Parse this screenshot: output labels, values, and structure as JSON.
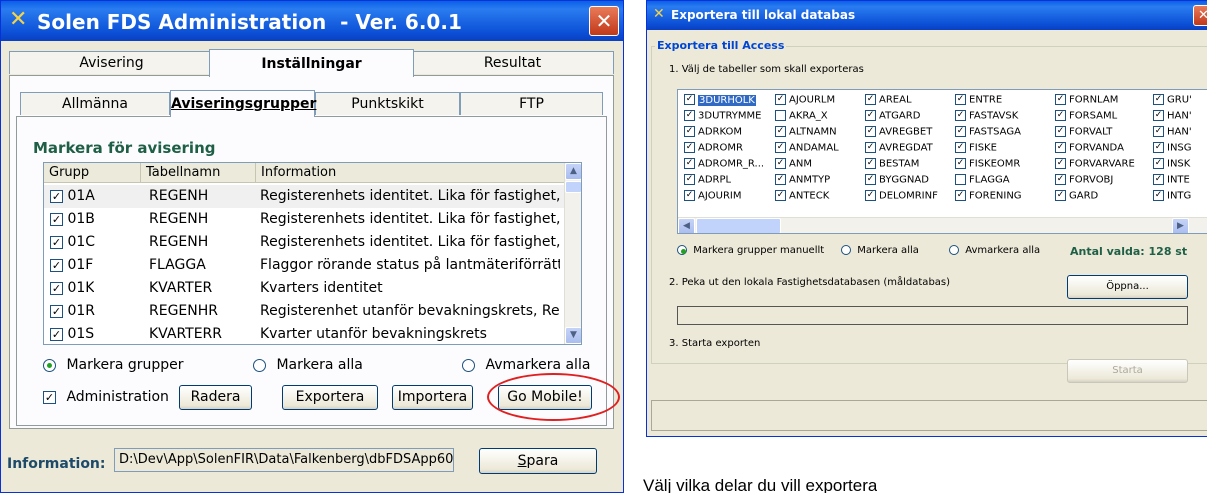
{
  "win1": {
    "title": "Solen FDS Administration  - Ver. 6.0.1",
    "tabs_top": [
      "Avisering",
      "Inställningar",
      "Resultat"
    ],
    "tabs_sub": [
      "Allmänna",
      "Aviseringsgrupper",
      "Punktskikt",
      "FTP"
    ],
    "section_title": "Markera för avisering",
    "columns": [
      "Grupp",
      "Tabellnamn",
      "Information"
    ],
    "rows": [
      {
        "grupp": "01A",
        "tabell": "REGENH",
        "info": "Registerenhets identitet. Lika för fastighet, sa"
      },
      {
        "grupp": "01B",
        "tabell": "REGENH",
        "info": "Registerenhets identitet. Lika för fastighet, sa"
      },
      {
        "grupp": "01C",
        "tabell": "REGENH",
        "info": "Registerenhets identitet. Lika för fastighet, sa"
      },
      {
        "grupp": "01F",
        "tabell": "FLAGGA",
        "info": "Flaggor rörande status på lantmäteriförrättning"
      },
      {
        "grupp": "01K",
        "tabell": "KVARTER",
        "info": "Kvarters identitet"
      },
      {
        "grupp": "01R",
        "tabell": "REGENHR",
        "info": "Registerenhet utanför bevakningskrets, Regis..."
      },
      {
        "grupp": "01S",
        "tabell": "KVARTERR",
        "info": "Kvarter utanför bevakningskrets"
      }
    ],
    "radio": [
      "Markera grupper",
      "Markera alla",
      "Avmarkera alla"
    ],
    "admin_label": "Administration",
    "buttons": [
      "Radera",
      "Exportera",
      "Importera",
      "Go Mobile!"
    ],
    "info_label": "Information:",
    "info_path": "D:\\Dev\\App\\SolenFIR\\Data\\Falkenberg\\dbFDSApp60.",
    "save_label": "Spara",
    "save_accel": "S",
    "save_rest": "para"
  },
  "win2": {
    "title": "Exportera till lokal databas",
    "group_title": "Exportera till Access",
    "step1": "1. Välj de tabeller som skall exporteras",
    "columns": [
      [
        {
          "t": "3DURHOLK",
          "c": true
        },
        {
          "t": "3DUTRYMME",
          "c": true
        },
        {
          "t": "ADRKOM",
          "c": true
        },
        {
          "t": "ADROMR",
          "c": true
        },
        {
          "t": "ADROMR_R...",
          "c": true
        },
        {
          "t": "ADRPL",
          "c": true
        },
        {
          "t": "AJOURIM",
          "c": true
        }
      ],
      [
        {
          "t": "AJOURLM",
          "c": true
        },
        {
          "t": "AKRA_X",
          "c": false
        },
        {
          "t": "ALTNAMN",
          "c": true
        },
        {
          "t": "ANDAMAL",
          "c": true
        },
        {
          "t": "ANM",
          "c": true
        },
        {
          "t": "ANMTYP",
          "c": true
        },
        {
          "t": "ANTECK",
          "c": true
        }
      ],
      [
        {
          "t": "AREAL",
          "c": true
        },
        {
          "t": "ATGARD",
          "c": true
        },
        {
          "t": "AVREGBET",
          "c": true
        },
        {
          "t": "AVREGDAT",
          "c": true
        },
        {
          "t": "BESTAM",
          "c": true
        },
        {
          "t": "BYGGNAD",
          "c": true
        },
        {
          "t": "DELOMRINF",
          "c": true
        }
      ],
      [
        {
          "t": "ENTRE",
          "c": true
        },
        {
          "t": "FASTAVSK",
          "c": true
        },
        {
          "t": "FASTSAGA",
          "c": true
        },
        {
          "t": "FISKE",
          "c": true
        },
        {
          "t": "FISKEOMR",
          "c": true
        },
        {
          "t": "FLAGGA",
          "c": false
        },
        {
          "t": "FORENING",
          "c": true
        }
      ],
      [
        {
          "t": "FORNLAM",
          "c": true
        },
        {
          "t": "FORSAML",
          "c": true
        },
        {
          "t": "FORVALT",
          "c": true
        },
        {
          "t": "FORVANDA",
          "c": true
        },
        {
          "t": "FORVARVARE",
          "c": true
        },
        {
          "t": "FORVOBJ",
          "c": true
        },
        {
          "t": "GARD",
          "c": true
        }
      ],
      [
        {
          "t": "GRU'",
          "c": true
        },
        {
          "t": "HAN'",
          "c": true
        },
        {
          "t": "HAN'",
          "c": true
        },
        {
          "t": "INSG",
          "c": true
        },
        {
          "t": "INSK",
          "c": true
        },
        {
          "t": "INTE",
          "c": true
        },
        {
          "t": "INTG",
          "c": true
        }
      ]
    ],
    "radio": [
      "Markera grupper manuellt",
      "Markera alla",
      "Avmarkera alla"
    ],
    "count": "Antal valda: 128 st",
    "step2": "2. Peka ut den lokala Fastighetsdatabasen (måldatabas)",
    "open_btn": "Öppna...",
    "step3": "3. Starta exporten",
    "start_btn": "Starta"
  },
  "caption": "Välj vilka delar du vill exportera"
}
